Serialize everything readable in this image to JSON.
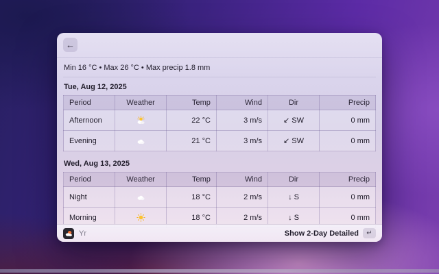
{
  "window": {
    "back_label": "←",
    "summary": "Min 16 °C • Max 26 °C • Max precip 1.8 mm",
    "columns": [
      "Period",
      "Weather",
      "Temp",
      "Wind",
      "Dir",
      "Precip"
    ],
    "days": [
      {
        "title": "Tue, Aug 12, 2025",
        "rows": [
          {
            "period": "Afternoon",
            "icon": "sun-behind-cloud",
            "temp": "22 °C",
            "wind": "3 m/s",
            "dir": "↙ SW",
            "precip": "0 mm"
          },
          {
            "period": "Evening",
            "icon": "cloud",
            "temp": "21 °C",
            "wind": "3 m/s",
            "dir": "↙ SW",
            "precip": "0 mm"
          }
        ]
      },
      {
        "title": "Wed, Aug 13, 2025",
        "rows": [
          {
            "period": "Night",
            "icon": "cloud",
            "temp": "18 °C",
            "wind": "2 m/s",
            "dir": "↓ S",
            "precip": "0 mm"
          },
          {
            "period": "Morning",
            "icon": "sun",
            "temp": "18 °C",
            "wind": "2 m/s",
            "dir": "↓ S",
            "precip": "0 mm"
          }
        ]
      }
    ],
    "footer": {
      "app_name": "Yr",
      "app_icon": "yr-app-icon",
      "action_label": "Show 2-Day Detailed",
      "action_key": "↵"
    }
  },
  "colors": {
    "wallpaper_navy": "#1c1950",
    "wallpaper_purple": "#5c2ba6",
    "wallpaper_pink": "#d898d2",
    "wallpaper_maroon": "#4e1e3e",
    "window_lavender": "#dad4ec",
    "window_pink": "#ecdfee",
    "text_primary": "#211d2b",
    "text_secondary": "#7f7b8a",
    "sun_yellow": "#fcc32f",
    "cloud_white": "#ffffff"
  }
}
